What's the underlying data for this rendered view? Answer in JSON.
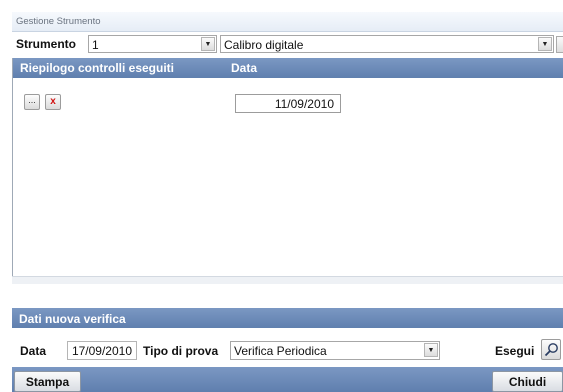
{
  "window": {
    "title": "Gestione Strumento"
  },
  "strumento": {
    "label": "Strumento",
    "code_value": "1",
    "description_value": "Calibro digitale"
  },
  "controlli": {
    "headers": [
      "Riepilogo controlli eseguiti",
      "Data"
    ],
    "rows": [
      {
        "data": "11/09/2010"
      }
    ],
    "open_button_label": "...",
    "delete_button_label": "x"
  },
  "nuova_verifica": {
    "title": "Dati nuova verifica",
    "data_label": "Data",
    "data_value": "17/09/2010",
    "tipo_label": "Tipo di prova",
    "tipo_value": "Verifica Periodica",
    "esegui_label": "Esegui"
  },
  "actions": {
    "stampa_label": "Stampa",
    "chiudi_label": "Chiudi"
  },
  "colors": {
    "header_blue": "#6886b6",
    "delete_red": "#d01010"
  }
}
